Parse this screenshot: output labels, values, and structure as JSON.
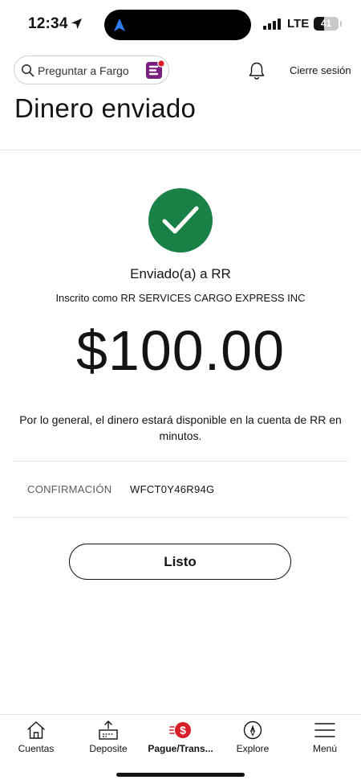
{
  "status_bar": {
    "time": "12:34",
    "network": "LTE",
    "battery_level": "41",
    "battery_fraction": 0.41
  },
  "header": {
    "search_placeholder": "Preguntar a Fargo",
    "logout_label": "Cierre sesión"
  },
  "page_title": "Dinero enviado",
  "confirmation": {
    "sent_to": "Enviado(a) a RR",
    "enrolled_as": "Inscrito como RR SERVICES CARGO EXPRESS INC",
    "amount": "$100.00",
    "notice": "Por lo general, el dinero estará disponible en la cuenta de RR en minutos.",
    "code_label": "CONFIRMACIÓN",
    "code_value": "WFCT0Y46R94G",
    "done_label": "Listo"
  },
  "tabbar": {
    "items": [
      {
        "label": "Cuentas",
        "icon": "home-icon",
        "active": false
      },
      {
        "label": "Deposite",
        "icon": "deposit-icon",
        "active": false
      },
      {
        "label": "Pague/Trans...",
        "icon": "pay-transfer-icon",
        "active": true
      },
      {
        "label": "Explore",
        "icon": "compass-icon",
        "active": false
      },
      {
        "label": "Menú",
        "icon": "menu-icon",
        "active": false
      }
    ]
  },
  "colors": {
    "success_green": "#1a8146",
    "accent_red": "#d71e28",
    "fargo_purple": "#7a1d7e",
    "text": "#141414"
  }
}
